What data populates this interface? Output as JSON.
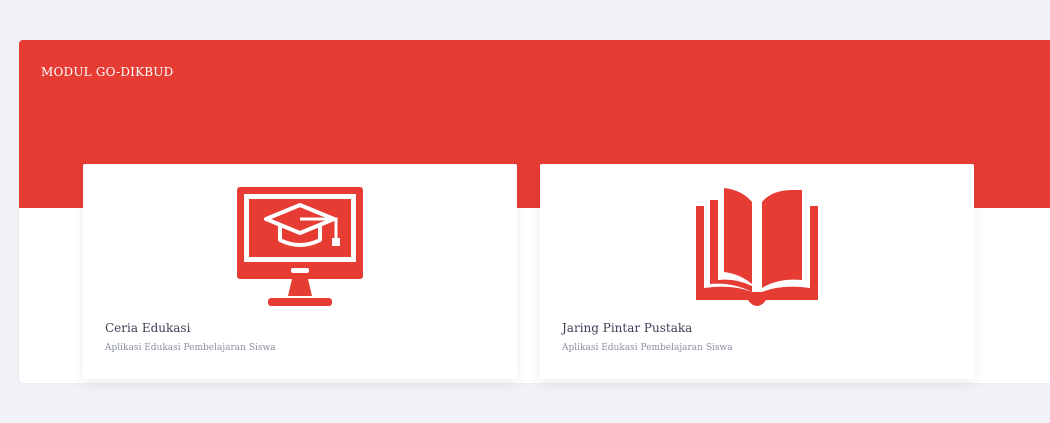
{
  "module": {
    "title": "MODUL GO-DIKBUD"
  },
  "cards": [
    {
      "title": "Ceria Edukasi",
      "subtitle": "Aplikasi Edukasi Pembelajaran Siswa",
      "icon": "computer-graduation-cap-icon"
    },
    {
      "title": "Jaring Pintar Pustaka",
      "subtitle": "Aplikasi Edukasi Pembelajaran Siswa",
      "icon": "open-book-icon"
    }
  ],
  "colors": {
    "accent": "#e63c34",
    "background": "#f1f2f7",
    "card": "#ffffff",
    "title_text": "#3c4254",
    "subtitle_text": "#8a8fa3"
  }
}
